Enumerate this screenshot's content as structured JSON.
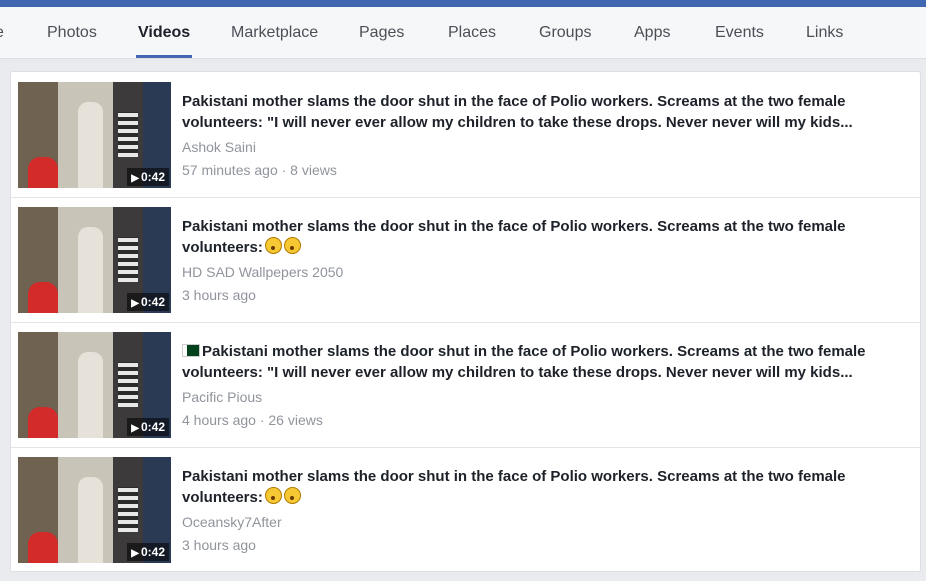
{
  "tabs": [
    {
      "label": "e"
    },
    {
      "label": "Photos"
    },
    {
      "label": "Videos"
    },
    {
      "label": "Marketplace"
    },
    {
      "label": "Pages"
    },
    {
      "label": "Places"
    },
    {
      "label": "Groups"
    },
    {
      "label": "Apps"
    },
    {
      "label": "Events"
    },
    {
      "label": "Links"
    }
  ],
  "active_tab": "Videos",
  "results": [
    {
      "title_line1": "Pakistani mother slams the door shut in the face of Polio workers. Screams at the two female",
      "title_line2": "volunteers: \"I will never ever allow my children to take these drops. Never never will my kids...",
      "author": "Ashok Saini",
      "meta": "57 minutes ago · 8 views",
      "duration": "0:42"
    },
    {
      "title_line1": "Pakistani mother slams the door shut in the face of Polio workers. Screams at the two female",
      "title_line2": "volunteers:",
      "emojis": [
        "astonished-emoji",
        "confused-emoji"
      ],
      "author": "HD SAD Wallpepers 2050",
      "meta": "3 hours ago",
      "duration": "0:42"
    },
    {
      "title_line1": "Pakistani mother slams the door shut in the face of Polio workers. Screams at the two female",
      "title_line2": "volunteers: \"I will never ever allow my children to take these drops. Never never will my kids...",
      "flag_icon": "pakistan-flag-icon",
      "author": "Pacific Pious",
      "meta": "4 hours ago · 26 views",
      "duration": "0:42"
    },
    {
      "title_line1": "Pakistani mother slams the door shut in the face of Polio workers. Screams at the two female",
      "title_line2": "volunteers:",
      "emojis": [
        "astonished-emoji",
        "confused-emoji"
      ],
      "author": "Oceansky7After",
      "meta": "3 hours ago",
      "duration": "0:42"
    }
  ],
  "colors": {
    "brand": "#4267b2",
    "title": "#1d2129",
    "meta": "#90949c"
  }
}
